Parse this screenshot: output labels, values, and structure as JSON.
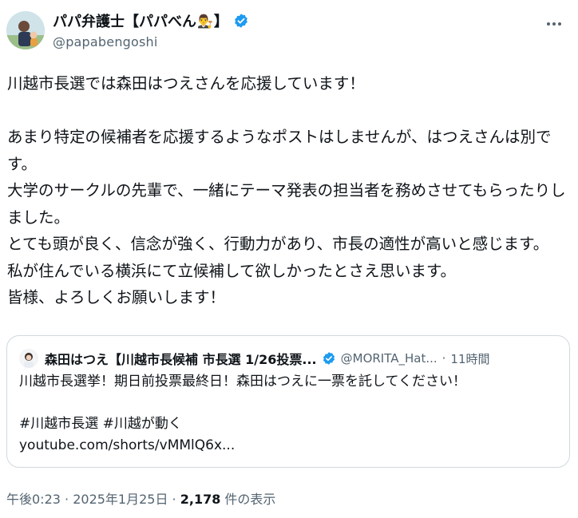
{
  "author": {
    "display_name": "パパ弁護士【パパべん",
    "name_emoji": "👨‍⚖️",
    "name_suffix": "】",
    "handle": "@papabengoshi",
    "verified_color": "#1d9bf0"
  },
  "more_icon": "more-horizontal-icon",
  "tweet": {
    "text": "川越市長選では森田はつえさんを応援しています！\n\nあまり特定の候補者を応援するようなポストはしませんが、はつえさんは別です。\n大学のサークルの先輩で、一緒にテーマ発表の担当者を務めさせてもらったりしました。\nとても頭が良く、信念が強く、行動力があり、市長の適性が高いと感じます。\n私が住んでいる横浜にて立候補して欲しかったとさえ思います。\n皆様、よろしくお願いします！"
  },
  "quote": {
    "name": "森田はつえ【川越市長候補 市長選 1/26投票...",
    "handle": "@MORITA_Hat...",
    "separator": "·",
    "time": "11時間",
    "text": "川越市長選挙！期日前投票最終日！森田はつえに一票を託してください！\n\n#川越市長選 #川越が動く\nyoutube.com/shorts/vMMlQ6x..."
  },
  "meta": {
    "time": "午後0:23",
    "sep1": " · ",
    "date": "2025年1月25日",
    "sep2": " · ",
    "views_count": "2,178",
    "views_label": " 件の表示"
  }
}
